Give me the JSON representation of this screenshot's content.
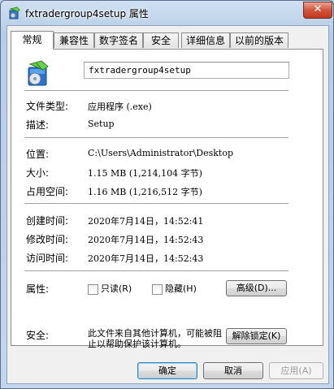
{
  "window": {
    "title": "fxtradergroup4setup 属性",
    "close_label": "✕"
  },
  "tabs": [
    {
      "label": "常规"
    },
    {
      "label": "兼容性"
    },
    {
      "label": "数字签名"
    },
    {
      "label": "安全"
    },
    {
      "label": "详细信息"
    },
    {
      "label": "以前的版本"
    }
  ],
  "general": {
    "file_name": "fxtradergroup4setup",
    "file_type_label": "文件类型:",
    "file_type_value": "应用程序 (.exe)",
    "description_label": "描述:",
    "description_value": "Setup",
    "location_label": "位置:",
    "location_value": "C:\\Users\\Administrator\\Desktop",
    "size_label": "大小:",
    "size_value": "1.15 MB (1,214,104 字节)",
    "size_on_disk_label": "占用空间:",
    "size_on_disk_value": "1.16 MB (1,216,512 字节)",
    "created_label": "创建时间:",
    "created_value": "2020年7月14日，14:52:41",
    "modified_label": "修改时间:",
    "modified_value": "2020年7月14日，14:52:43",
    "accessed_label": "访问时间:",
    "accessed_value": "2020年7月14日，14:52:43",
    "attributes_label": "属性:",
    "readonly_label": "只读(R)",
    "hidden_label": "隐藏(H)",
    "advanced_button": "高级(D)...",
    "security_label": "安全:",
    "security_text": "此文件来自其他计算机，可能被阻止以帮助保护该计算机。",
    "unblock_button": "解除锁定(K)"
  },
  "footer": {
    "ok_button": "确定",
    "cancel_button": "取消",
    "apply_button": "应用(A)"
  }
}
